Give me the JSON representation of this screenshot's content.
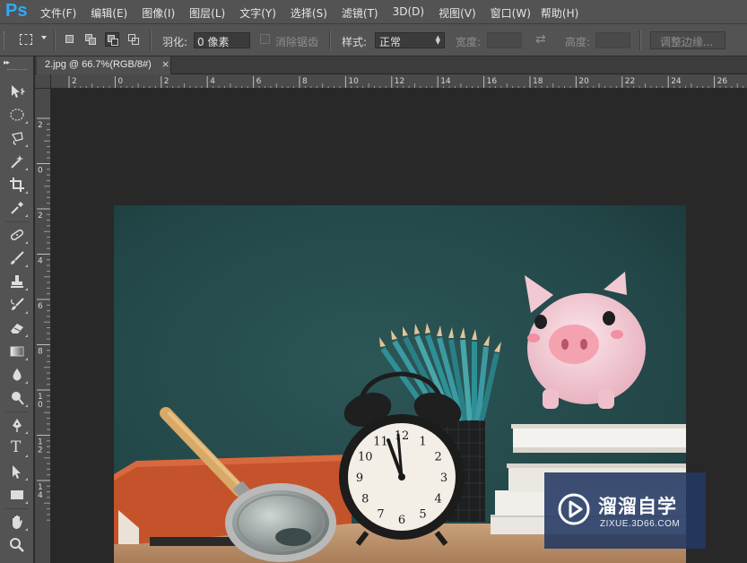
{
  "app": {
    "logo_text": "Ps",
    "accent": "#31a8ff"
  },
  "menu": {
    "items": [
      "文件(F)",
      "编辑(E)",
      "图像(I)",
      "图层(L)",
      "文字(Y)",
      "选择(S)",
      "滤镜(T)",
      "3D(D)",
      "视图(V)",
      "窗口(W)",
      "帮助(H)"
    ]
  },
  "options_bar": {
    "feather_label": "羽化:",
    "feather_value": "0 像素",
    "antialias_label": "消除锯齿",
    "antialias_checked": false,
    "style_label": "样式:",
    "style_value": "正常",
    "width_label": "宽度:",
    "height_label": "高度:",
    "refine_edge_label": "调整边缘..."
  },
  "document": {
    "tab_title": "2.jpg @ 66.7%(RGB/8#)",
    "close_glyph": "×"
  },
  "rulers": {
    "horizontal_labels": [
      "2",
      "0",
      "2",
      "4",
      "6",
      "8",
      "10",
      "12",
      "14",
      "16",
      "18",
      "20",
      "22",
      "24",
      "26"
    ],
    "vertical_labels": [
      "2",
      "0",
      "2",
      "4",
      "6",
      "8",
      "10",
      "12",
      "14"
    ]
  },
  "tools": [
    {
      "name": "move-tool",
      "icon": "move-icon"
    },
    {
      "name": "marquee-tool",
      "icon": "ellipse-marquee-icon"
    },
    {
      "name": "lasso-tool",
      "icon": "lasso-icon"
    },
    {
      "name": "magic-wand-tool",
      "icon": "magic-wand-icon"
    },
    {
      "name": "crop-tool",
      "icon": "crop-icon"
    },
    {
      "name": "eyedropper-tool",
      "icon": "eyedropper-icon"
    },
    {
      "name": "healing-brush-tool",
      "icon": "bandage-icon"
    },
    {
      "name": "brush-tool",
      "icon": "brush-icon"
    },
    {
      "name": "clone-stamp-tool",
      "icon": "stamp-icon"
    },
    {
      "name": "history-brush-tool",
      "icon": "history-brush-icon"
    },
    {
      "name": "eraser-tool",
      "icon": "eraser-icon"
    },
    {
      "name": "gradient-tool",
      "icon": "gradient-icon"
    },
    {
      "name": "blur-tool",
      "icon": "drop-icon"
    },
    {
      "name": "dodge-tool",
      "icon": "dodge-icon"
    },
    {
      "name": "pen-tool",
      "icon": "pen-icon"
    },
    {
      "name": "type-tool",
      "icon": "type-icon",
      "glyph": "T"
    },
    {
      "name": "path-selection-tool",
      "icon": "arrow-icon"
    },
    {
      "name": "rectangle-tool",
      "icon": "rectangle-icon"
    },
    {
      "name": "hand-tool",
      "icon": "hand-icon"
    },
    {
      "name": "zoom-tool",
      "icon": "zoom-icon"
    }
  ],
  "clock": {
    "numerals": [
      "12",
      "1",
      "2",
      "3",
      "4",
      "5",
      "6",
      "7",
      "8",
      "9",
      "10",
      "11"
    ]
  },
  "watermark": {
    "title": "溜溜自学",
    "url": "ZIXUE.3D66.COM"
  }
}
